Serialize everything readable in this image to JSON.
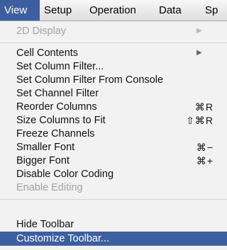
{
  "menubar": {
    "items": [
      "View",
      "Setup",
      "Operation",
      "Data",
      "Sp"
    ]
  },
  "menu": {
    "display_2d": "2D Display",
    "cell_contents": "Cell Contents",
    "set_column_filter": "Set Column Filter...",
    "set_column_filter_console": "Set Column Filter From Console",
    "set_channel_filter": "Set Channel Filter",
    "reorder_columns": "Reorder Columns",
    "reorder_columns_sc": "⌘R",
    "size_columns_to_fit": "Size Columns to Fit",
    "size_columns_to_fit_sc": "⇧⌘R",
    "freeze_channels": "Freeze Channels",
    "smaller_font": "Smaller Font",
    "smaller_font_sc": "⌘−",
    "bigger_font": "Bigger Font",
    "bigger_font_sc": "⌘+",
    "disable_color_coding": "Disable Color Coding",
    "enable_editing": "Enable Editing",
    "hide_toolbar": "Hide Toolbar",
    "customize_toolbar": "Customize Toolbar..."
  },
  "icons": {
    "submenu_arrow": "submenu-arrow-icon"
  },
  "colors": {
    "highlight": "#3d5f9f",
    "menu_bg": "#f2f2f2",
    "disabled_text": "#a2a2a2"
  }
}
